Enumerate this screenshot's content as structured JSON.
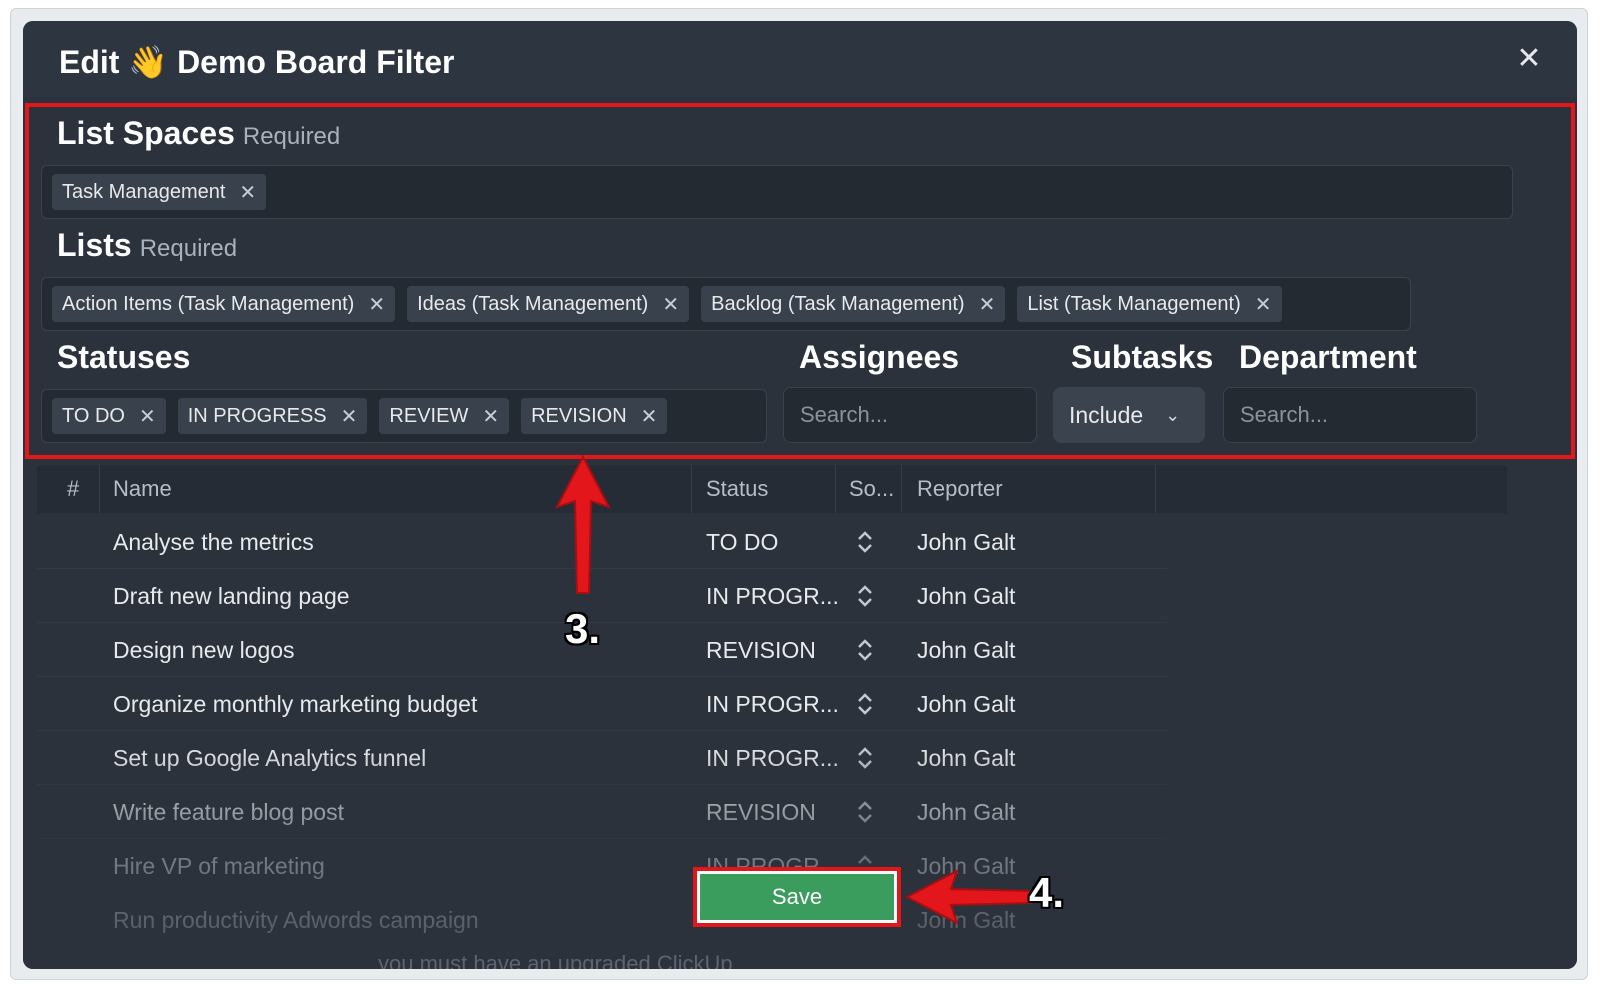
{
  "modal": {
    "title": "Edit 👋 Demo Board Filter",
    "close_icon": "close-icon"
  },
  "list_spaces": {
    "label": "List Spaces",
    "required": "Required",
    "chips": [
      "Task Management"
    ]
  },
  "lists": {
    "label": "Lists",
    "required": "Required",
    "chips": [
      "Action Items (Task Management)",
      "Ideas (Task Management)",
      "Backlog (Task Management)",
      "List (Task Management)"
    ]
  },
  "statuses": {
    "label": "Statuses",
    "chips": [
      "TO DO",
      "IN PROGRESS",
      "REVIEW",
      "REVISION"
    ]
  },
  "assignees": {
    "label": "Assignees",
    "placeholder": "Search..."
  },
  "subtasks": {
    "label": "Subtasks",
    "value": "Include"
  },
  "department": {
    "label": "Department",
    "placeholder": "Search..."
  },
  "table": {
    "columns": [
      "#",
      "Name",
      "Status",
      "So...",
      "Reporter"
    ],
    "rows": [
      {
        "name": "Analyse the metrics",
        "status": "TO DO",
        "reporter": "John Galt"
      },
      {
        "name": "Draft new landing page",
        "status": "IN PROGR...",
        "reporter": "John Galt"
      },
      {
        "name": "Design new logos",
        "status": "REVISION",
        "reporter": "John Galt"
      },
      {
        "name": "Organize monthly marketing budget",
        "status": "IN PROGR...",
        "reporter": "John Galt"
      },
      {
        "name": "Set up Google Analytics funnel",
        "status": "IN PROGR...",
        "reporter": "John Galt"
      },
      {
        "name": "Write feature blog post",
        "status": "REVISION",
        "reporter": "John Galt"
      },
      {
        "name": "Hire VP of marketing",
        "status": "IN PROGR...",
        "reporter": "John Galt"
      },
      {
        "name": "Run productivity Adwords campaign",
        "status": "",
        "reporter": "John Galt"
      }
    ]
  },
  "hint_text": "you must have an upgraded ClickUp",
  "save_label": "Save",
  "annotations": {
    "step3": "3.",
    "step4": "4."
  },
  "colors": {
    "modal_bg": "#2b323c",
    "highlight": "#e3161b",
    "save_green": "#3a9d5d"
  }
}
